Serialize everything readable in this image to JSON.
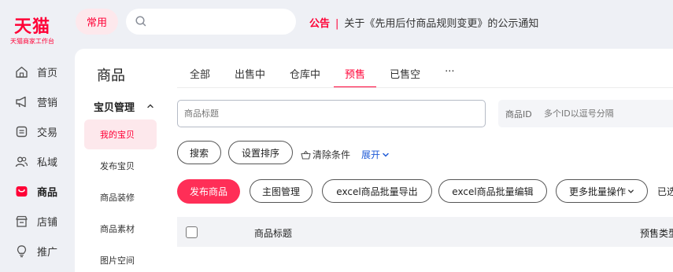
{
  "logo": {
    "brand": "天猫",
    "subtitle": "天猫商家工作台"
  },
  "topbar": {
    "common_label": "常用",
    "search_placeholder": "",
    "notice_tag": "公告",
    "notice_separator": "|",
    "notice_text": "关于《先用后付商品规则变更》的公示通知"
  },
  "nav": {
    "items": [
      {
        "label": "首页",
        "icon": "home-icon"
      },
      {
        "label": "营销",
        "icon": "megaphone-icon"
      },
      {
        "label": "交易",
        "icon": "receipt-icon"
      },
      {
        "label": "私域",
        "icon": "users-icon"
      },
      {
        "label": "商品",
        "icon": "product-icon"
      },
      {
        "label": "店铺",
        "icon": "store-icon"
      },
      {
        "label": "推广",
        "icon": "bulb-icon"
      }
    ],
    "active": "商品"
  },
  "panel": {
    "title": "商品"
  },
  "subnav": {
    "group_label": "宝贝管理",
    "items": [
      "我的宝贝",
      "发布宝贝",
      "商品装修",
      "商品素材",
      "图片空间"
    ],
    "active": "我的宝贝"
  },
  "tabs": [
    "全部",
    "出售中",
    "仓库中",
    "预售",
    "已售空",
    "···"
  ],
  "active_tab": "预售",
  "filters": {
    "title_placeholder": "商品标题",
    "id_label": "商品ID",
    "id_placeholder": "多个ID以逗号分隔"
  },
  "actions": {
    "search": "搜索",
    "sort": "设置排序",
    "clear": "清除条件",
    "expand": "展开",
    "publish": "发布商品",
    "main_image": "主图管理",
    "export": "excel商品批量导出",
    "bulk_edit": "excel商品批量编辑",
    "more_bulk": "更多批量操作",
    "selected": "已选"
  },
  "table": {
    "columns": [
      "商品标题",
      "预售类型"
    ]
  },
  "colors": {
    "accent": "#ff0036",
    "accent_soft": "#fde8ec",
    "link": "#1f5bd7"
  }
}
